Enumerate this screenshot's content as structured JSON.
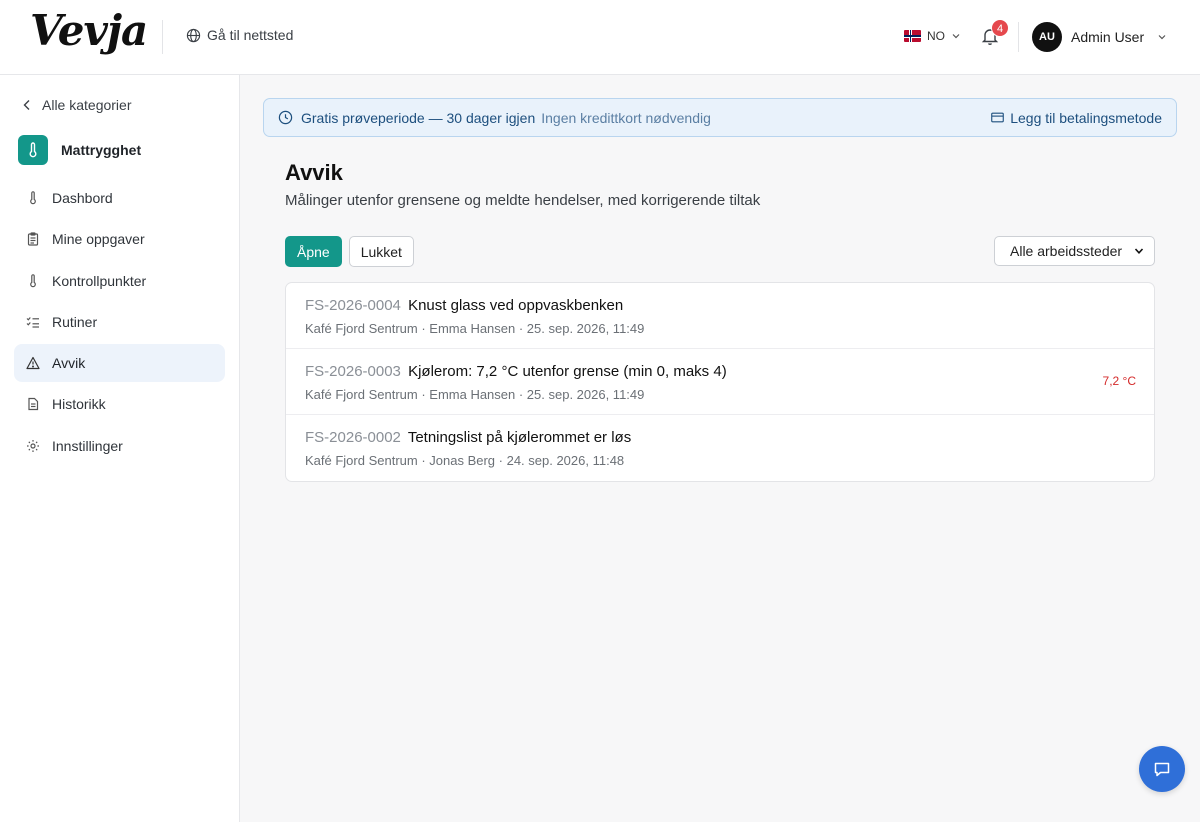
{
  "header": {
    "logo": "Vevja",
    "goto_site": "Gå til nettsted",
    "language": "NO",
    "notifications_count": "4",
    "user_initials": "AU",
    "user_name": "Admin User"
  },
  "sidebar": {
    "back_label": "Alle kategorier",
    "category_name": "Mattrygghet",
    "category_color": "#13978a",
    "items": [
      {
        "label": "Dashbord",
        "icon": "thermometer-icon",
        "active": false
      },
      {
        "label": "Mine oppgaver",
        "icon": "clipboard-icon",
        "active": false
      },
      {
        "label": "Kontrollpunkter",
        "icon": "thermometer-icon",
        "active": false
      },
      {
        "label": "Rutiner",
        "icon": "checklist-icon",
        "active": false
      },
      {
        "label": "Avvik",
        "icon": "warning-triangle-icon",
        "active": true
      },
      {
        "label": "Historikk",
        "icon": "document-icon",
        "active": false
      },
      {
        "label": "Innstillinger",
        "icon": "gear-icon",
        "active": false
      }
    ]
  },
  "banner": {
    "title": "Gratis prøveperiode — 30 dager igjen",
    "subtitle": "Ingen kredittkort nødvendig",
    "action": "Legg til betalingsmetode"
  },
  "page": {
    "title": "Avvik",
    "subtitle": "Målinger utenfor grensene og meldte hendelser, med korrigerende tiltak"
  },
  "tabs": [
    {
      "label": "Åpne",
      "active": true
    },
    {
      "label": "Lukket",
      "active": false
    }
  ],
  "filter": {
    "selected": "Alle arbeidssteder"
  },
  "deviations": [
    {
      "id": "FS-2026-0004",
      "title": "Knust glass ved oppvaskbenken",
      "meta": "Kafé Fjord Sentrum · Emma Hansen · 25. sep. 2026, 11:49",
      "value": ""
    },
    {
      "id": "FS-2026-0003",
      "title": "Kjølerom: 7,2 °C utenfor grense (min 0, maks 4)",
      "meta": "Kafé Fjord Sentrum · Emma Hansen · 25. sep. 2026, 11:49",
      "value": "7,2 °C"
    },
    {
      "id": "FS-2026-0002",
      "title": "Tetningslist på kjølerommet er løs",
      "meta": "Kafé Fjord Sentrum · Jonas Berg · 24. sep. 2026, 11:48",
      "value": ""
    }
  ],
  "colors": {
    "accent": "#13978a",
    "warning_value": "#d42a2a",
    "chat_button": "#2f6fd8"
  }
}
